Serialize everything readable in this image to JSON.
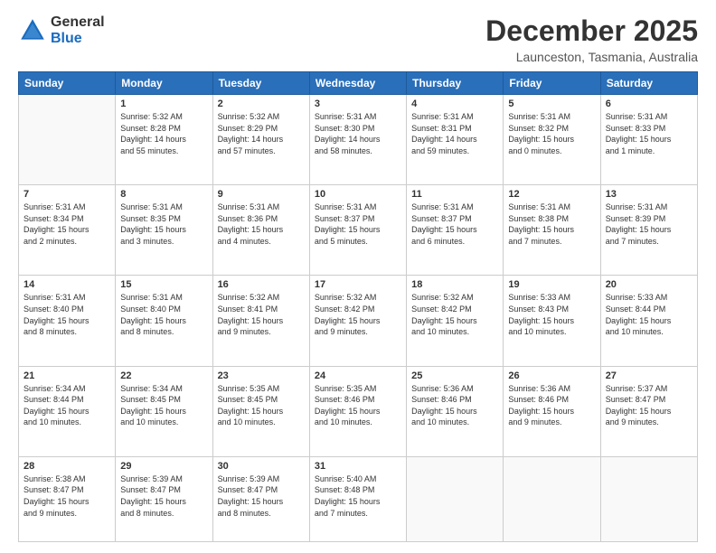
{
  "header": {
    "logo_general": "General",
    "logo_blue": "Blue",
    "month": "December 2025",
    "location": "Launceston, Tasmania, Australia"
  },
  "days": [
    "Sunday",
    "Monday",
    "Tuesday",
    "Wednesday",
    "Thursday",
    "Friday",
    "Saturday"
  ],
  "weeks": [
    [
      {
        "num": "",
        "info": ""
      },
      {
        "num": "1",
        "info": "Sunrise: 5:32 AM\nSunset: 8:28 PM\nDaylight: 14 hours\nand 55 minutes."
      },
      {
        "num": "2",
        "info": "Sunrise: 5:32 AM\nSunset: 8:29 PM\nDaylight: 14 hours\nand 57 minutes."
      },
      {
        "num": "3",
        "info": "Sunrise: 5:31 AM\nSunset: 8:30 PM\nDaylight: 14 hours\nand 58 minutes."
      },
      {
        "num": "4",
        "info": "Sunrise: 5:31 AM\nSunset: 8:31 PM\nDaylight: 14 hours\nand 59 minutes."
      },
      {
        "num": "5",
        "info": "Sunrise: 5:31 AM\nSunset: 8:32 PM\nDaylight: 15 hours\nand 0 minutes."
      },
      {
        "num": "6",
        "info": "Sunrise: 5:31 AM\nSunset: 8:33 PM\nDaylight: 15 hours\nand 1 minute."
      }
    ],
    [
      {
        "num": "7",
        "info": "Sunrise: 5:31 AM\nSunset: 8:34 PM\nDaylight: 15 hours\nand 2 minutes."
      },
      {
        "num": "8",
        "info": "Sunrise: 5:31 AM\nSunset: 8:35 PM\nDaylight: 15 hours\nand 3 minutes."
      },
      {
        "num": "9",
        "info": "Sunrise: 5:31 AM\nSunset: 8:36 PM\nDaylight: 15 hours\nand 4 minutes."
      },
      {
        "num": "10",
        "info": "Sunrise: 5:31 AM\nSunset: 8:37 PM\nDaylight: 15 hours\nand 5 minutes."
      },
      {
        "num": "11",
        "info": "Sunrise: 5:31 AM\nSunset: 8:37 PM\nDaylight: 15 hours\nand 6 minutes."
      },
      {
        "num": "12",
        "info": "Sunrise: 5:31 AM\nSunset: 8:38 PM\nDaylight: 15 hours\nand 7 minutes."
      },
      {
        "num": "13",
        "info": "Sunrise: 5:31 AM\nSunset: 8:39 PM\nDaylight: 15 hours\nand 7 minutes."
      }
    ],
    [
      {
        "num": "14",
        "info": "Sunrise: 5:31 AM\nSunset: 8:40 PM\nDaylight: 15 hours\nand 8 minutes."
      },
      {
        "num": "15",
        "info": "Sunrise: 5:31 AM\nSunset: 8:40 PM\nDaylight: 15 hours\nand 8 minutes."
      },
      {
        "num": "16",
        "info": "Sunrise: 5:32 AM\nSunset: 8:41 PM\nDaylight: 15 hours\nand 9 minutes."
      },
      {
        "num": "17",
        "info": "Sunrise: 5:32 AM\nSunset: 8:42 PM\nDaylight: 15 hours\nand 9 minutes."
      },
      {
        "num": "18",
        "info": "Sunrise: 5:32 AM\nSunset: 8:42 PM\nDaylight: 15 hours\nand 10 minutes."
      },
      {
        "num": "19",
        "info": "Sunrise: 5:33 AM\nSunset: 8:43 PM\nDaylight: 15 hours\nand 10 minutes."
      },
      {
        "num": "20",
        "info": "Sunrise: 5:33 AM\nSunset: 8:44 PM\nDaylight: 15 hours\nand 10 minutes."
      }
    ],
    [
      {
        "num": "21",
        "info": "Sunrise: 5:34 AM\nSunset: 8:44 PM\nDaylight: 15 hours\nand 10 minutes."
      },
      {
        "num": "22",
        "info": "Sunrise: 5:34 AM\nSunset: 8:45 PM\nDaylight: 15 hours\nand 10 minutes."
      },
      {
        "num": "23",
        "info": "Sunrise: 5:35 AM\nSunset: 8:45 PM\nDaylight: 15 hours\nand 10 minutes."
      },
      {
        "num": "24",
        "info": "Sunrise: 5:35 AM\nSunset: 8:46 PM\nDaylight: 15 hours\nand 10 minutes."
      },
      {
        "num": "25",
        "info": "Sunrise: 5:36 AM\nSunset: 8:46 PM\nDaylight: 15 hours\nand 10 minutes."
      },
      {
        "num": "26",
        "info": "Sunrise: 5:36 AM\nSunset: 8:46 PM\nDaylight: 15 hours\nand 9 minutes."
      },
      {
        "num": "27",
        "info": "Sunrise: 5:37 AM\nSunset: 8:47 PM\nDaylight: 15 hours\nand 9 minutes."
      }
    ],
    [
      {
        "num": "28",
        "info": "Sunrise: 5:38 AM\nSunset: 8:47 PM\nDaylight: 15 hours\nand 9 minutes."
      },
      {
        "num": "29",
        "info": "Sunrise: 5:39 AM\nSunset: 8:47 PM\nDaylight: 15 hours\nand 8 minutes."
      },
      {
        "num": "30",
        "info": "Sunrise: 5:39 AM\nSunset: 8:47 PM\nDaylight: 15 hours\nand 8 minutes."
      },
      {
        "num": "31",
        "info": "Sunrise: 5:40 AM\nSunset: 8:48 PM\nDaylight: 15 hours\nand 7 minutes."
      },
      {
        "num": "",
        "info": ""
      },
      {
        "num": "",
        "info": ""
      },
      {
        "num": "",
        "info": ""
      }
    ]
  ]
}
